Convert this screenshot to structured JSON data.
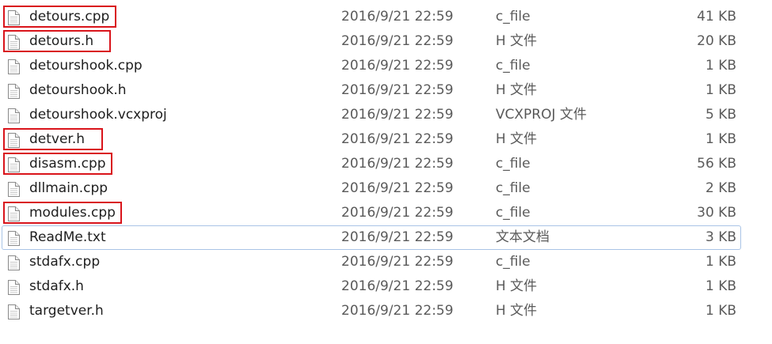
{
  "files": [
    {
      "name": "detours.cpp",
      "date": "2016/9/21 22:59",
      "type": "c_file",
      "size": "41 KB",
      "highlighted": true
    },
    {
      "name": "detours.h",
      "date": "2016/9/21 22:59",
      "type": "H 文件",
      "size": "20 KB",
      "highlighted": true
    },
    {
      "name": "detourshook.cpp",
      "date": "2016/9/21 22:59",
      "type": "c_file",
      "size": "1 KB",
      "highlighted": false
    },
    {
      "name": "detourshook.h",
      "date": "2016/9/21 22:59",
      "type": "H 文件",
      "size": "1 KB",
      "highlighted": false
    },
    {
      "name": "detourshook.vcxproj",
      "date": "2016/9/21 22:59",
      "type": "VCXPROJ 文件",
      "size": "5 KB",
      "highlighted": false
    },
    {
      "name": "detver.h",
      "date": "2016/9/21 22:59",
      "type": "H 文件",
      "size": "1 KB",
      "highlighted": true
    },
    {
      "name": "disasm.cpp",
      "date": "2016/9/21 22:59",
      "type": "c_file",
      "size": "56 KB",
      "highlighted": true
    },
    {
      "name": "dllmain.cpp",
      "date": "2016/9/21 22:59",
      "type": "c_file",
      "size": "2 KB",
      "highlighted": false
    },
    {
      "name": "modules.cpp",
      "date": "2016/9/21 22:59",
      "type": "c_file",
      "size": "30 KB",
      "highlighted": true
    },
    {
      "name": "ReadMe.txt",
      "date": "2016/9/21 22:59",
      "type": "文本文档",
      "size": "3 KB",
      "highlighted": false,
      "selected": true
    },
    {
      "name": "stdafx.cpp",
      "date": "2016/9/21 22:59",
      "type": "c_file",
      "size": "1 KB",
      "highlighted": false
    },
    {
      "name": "stdafx.h",
      "date": "2016/9/21 22:59",
      "type": "H 文件",
      "size": "1 KB",
      "highlighted": false
    },
    {
      "name": "targetver.h",
      "date": "2016/9/21 22:59",
      "type": "H 文件",
      "size": "1 KB",
      "highlighted": false
    }
  ],
  "colors": {
    "highlight_box": "#d9141b",
    "selection_border": "#a9c4e6",
    "icon_border": "#8a8a8a"
  },
  "icons": {
    "file": "document-icon"
  }
}
